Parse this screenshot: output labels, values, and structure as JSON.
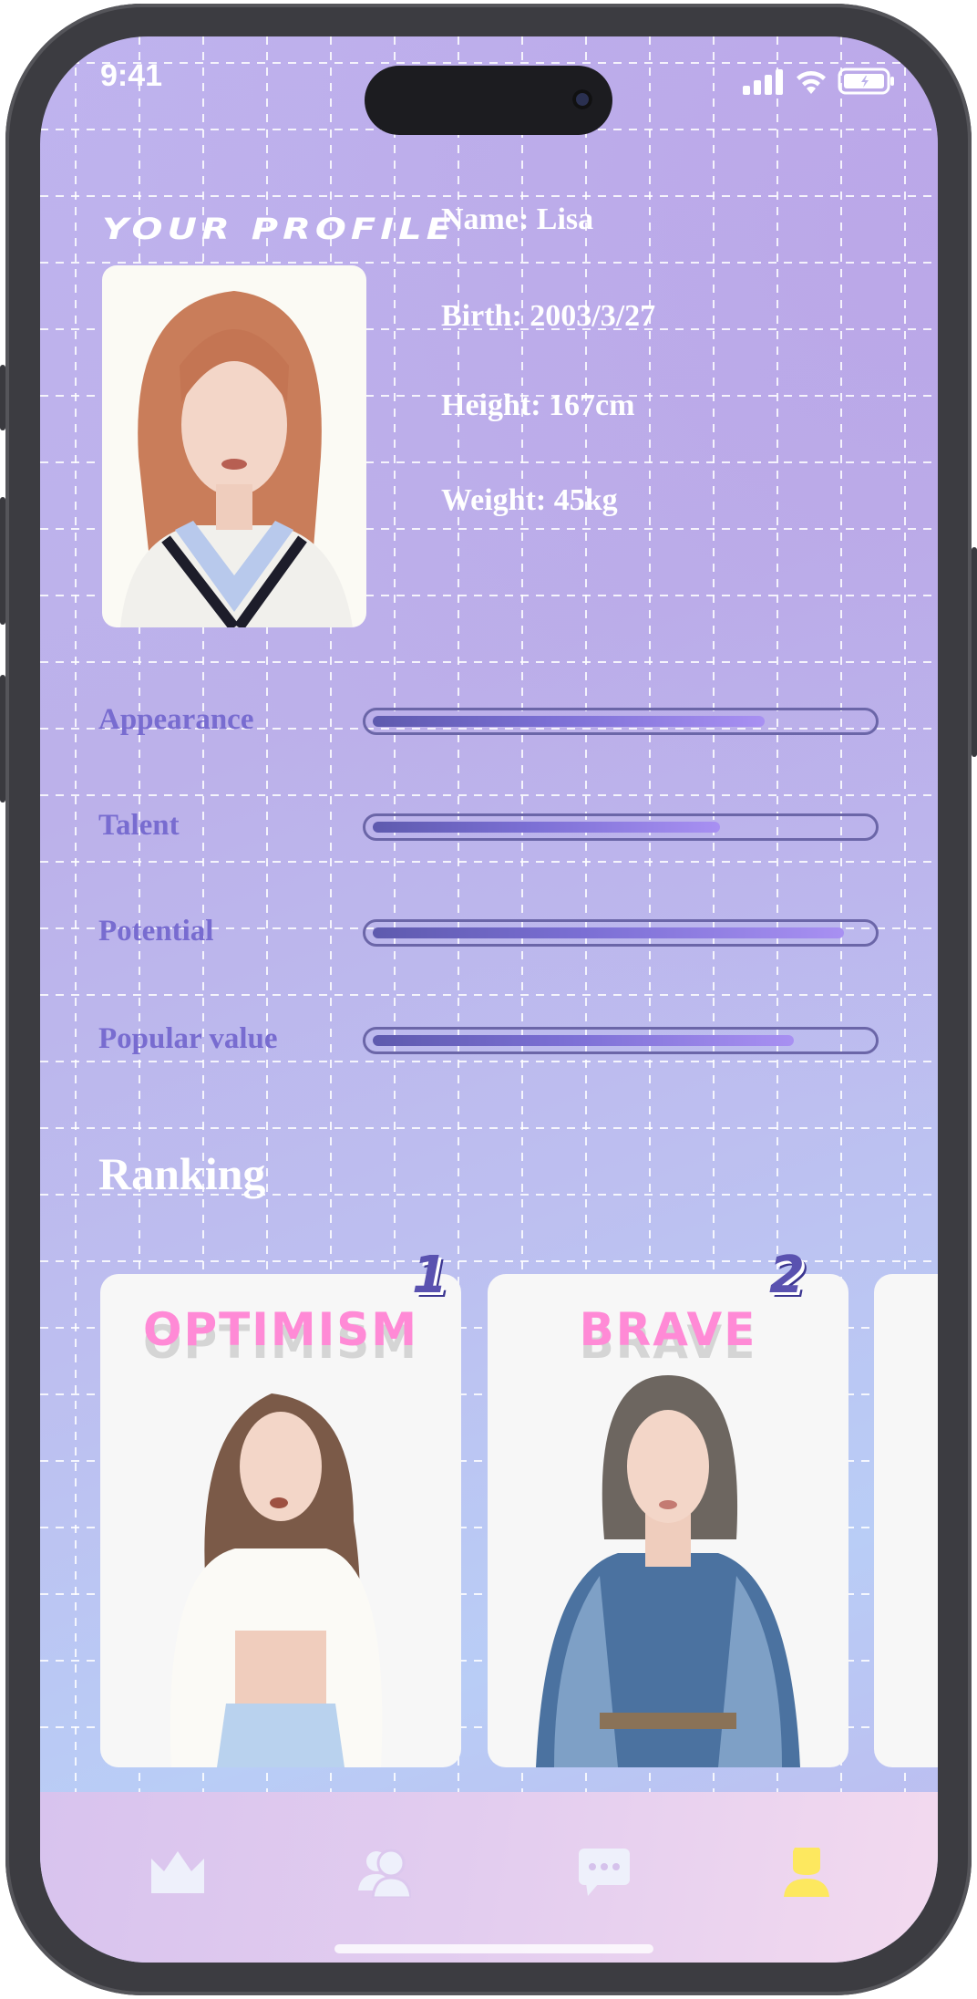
{
  "status_bar": {
    "time": "9:41",
    "icons": [
      "cellular-signal-icon",
      "wifi-icon",
      "battery-charging-icon"
    ]
  },
  "header": {
    "title": "YOUR PROFILE"
  },
  "profile": {
    "photo": "profile-photo",
    "name": "Name: Lisa",
    "birth": "Birth: 2003/3/27",
    "height": "Height: 167cm",
    "weight": "Weight: 45kg"
  },
  "stats": [
    {
      "label": "Appearance",
      "value": 0.79
    },
    {
      "label": "Talent",
      "value": 0.7
    },
    {
      "label": "Potential",
      "value": 0.95
    },
    {
      "label": "Popular value",
      "value": 0.85
    }
  ],
  "ranking": {
    "title": "Ranking",
    "cards": [
      {
        "rank": "1",
        "label": "OPTIMISM"
      },
      {
        "rank": "2",
        "label": "BRAVE"
      },
      {
        "rank": "",
        "label": ""
      }
    ]
  },
  "tab_bar": {
    "tabs": [
      {
        "icon": "crown-icon",
        "active": false
      },
      {
        "icon": "users-icon",
        "active": false
      },
      {
        "icon": "chat-icon",
        "active": false
      },
      {
        "icon": "profile-icon",
        "active": true
      }
    ]
  },
  "colors": {
    "accent_pink": "#ff8ad6",
    "stat_label": "#786cd0",
    "active_tab": "#fde85f",
    "inactive_tab": "#eef0fb"
  }
}
